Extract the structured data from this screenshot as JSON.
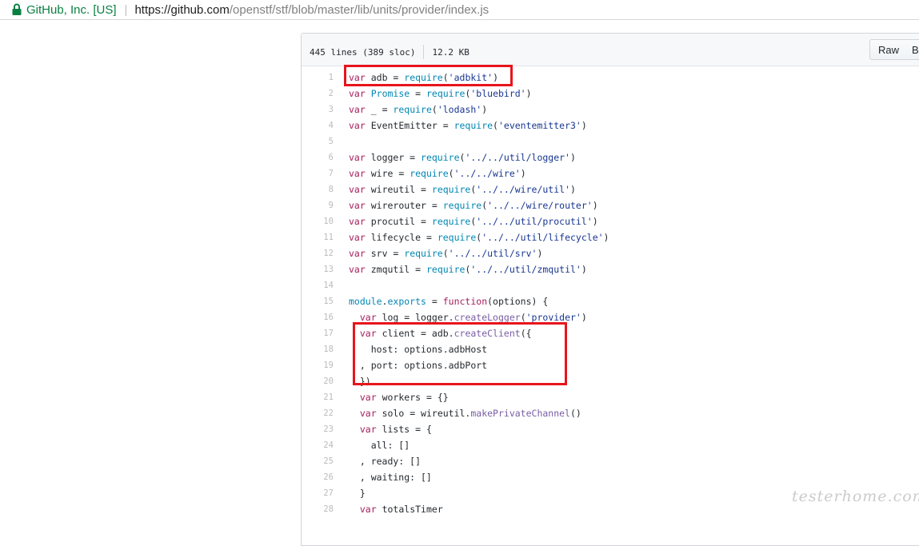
{
  "browser": {
    "secure_label": "GitHub, Inc. [US]",
    "url_host": "https://github.com",
    "url_path": "/openstf/stf/blob/master/lib/units/provider/index.js"
  },
  "file": {
    "lines_info": "445 lines (389 sloc)",
    "size": "12.2 KB",
    "raw_label": "Raw",
    "blame_label": "B"
  },
  "code_lines": [
    {
      "n": "1",
      "t": [
        [
          "kw",
          "var"
        ],
        [
          "",
          "adb = "
        ],
        [
          "bi",
          "require"
        ],
        [
          "",
          "("
        ],
        [
          "st",
          "'adbkit'"
        ],
        [
          "",
          ")"
        ]
      ]
    },
    {
      "n": "2",
      "t": [
        [
          "kw",
          "var"
        ],
        [
          "",
          ""
        ],
        [
          "bi",
          "Promise"
        ],
        [
          "",
          " = "
        ],
        [
          "bi",
          "require"
        ],
        [
          "",
          "("
        ],
        [
          "st",
          "'bluebird'"
        ],
        [
          "",
          ")"
        ]
      ]
    },
    {
      "n": "3",
      "t": [
        [
          "kw",
          "var"
        ],
        [
          "",
          "_ = "
        ],
        [
          "bi",
          "require"
        ],
        [
          "",
          "("
        ],
        [
          "st",
          "'lodash'"
        ],
        [
          "",
          ")"
        ]
      ]
    },
    {
      "n": "4",
      "t": [
        [
          "kw",
          "var"
        ],
        [
          "",
          "EventEmitter = "
        ],
        [
          "bi",
          "require"
        ],
        [
          "",
          "("
        ],
        [
          "st",
          "'eventemitter3'"
        ],
        [
          "",
          ")"
        ]
      ]
    },
    {
      "n": "5",
      "t": []
    },
    {
      "n": "6",
      "t": [
        [
          "kw",
          "var"
        ],
        [
          "",
          "logger = "
        ],
        [
          "bi",
          "require"
        ],
        [
          "",
          "("
        ],
        [
          "st",
          "'../../util/logger'"
        ],
        [
          "",
          ")"
        ]
      ]
    },
    {
      "n": "7",
      "t": [
        [
          "kw",
          "var"
        ],
        [
          "",
          "wire = "
        ],
        [
          "bi",
          "require"
        ],
        [
          "",
          "("
        ],
        [
          "st",
          "'../../wire'"
        ],
        [
          "",
          ")"
        ]
      ]
    },
    {
      "n": "8",
      "t": [
        [
          "kw",
          "var"
        ],
        [
          "",
          "wireutil = "
        ],
        [
          "bi",
          "require"
        ],
        [
          "",
          "("
        ],
        [
          "st",
          "'../../wire/util'"
        ],
        [
          "",
          ")"
        ]
      ]
    },
    {
      "n": "9",
      "t": [
        [
          "kw",
          "var"
        ],
        [
          "",
          "wirerouter = "
        ],
        [
          "bi",
          "require"
        ],
        [
          "",
          "("
        ],
        [
          "st",
          "'../../wire/router'"
        ],
        [
          "",
          ")"
        ]
      ]
    },
    {
      "n": "10",
      "t": [
        [
          "kw",
          "var"
        ],
        [
          "",
          "procutil = "
        ],
        [
          "bi",
          "require"
        ],
        [
          "",
          "("
        ],
        [
          "st",
          "'../../util/procutil'"
        ],
        [
          "",
          ")"
        ]
      ]
    },
    {
      "n": "11",
      "t": [
        [
          "kw",
          "var"
        ],
        [
          "",
          "lifecycle = "
        ],
        [
          "bi",
          "require"
        ],
        [
          "",
          "("
        ],
        [
          "st",
          "'../../util/lifecycle'"
        ],
        [
          "",
          ")"
        ]
      ]
    },
    {
      "n": "12",
      "t": [
        [
          "kw",
          "var"
        ],
        [
          "",
          "srv = "
        ],
        [
          "bi",
          "require"
        ],
        [
          "",
          "("
        ],
        [
          "st",
          "'../../util/srv'"
        ],
        [
          "",
          ")"
        ]
      ]
    },
    {
      "n": "13",
      "t": [
        [
          "kw",
          "var"
        ],
        [
          "",
          "zmqutil = "
        ],
        [
          "bi",
          "require"
        ],
        [
          "",
          "("
        ],
        [
          "st",
          "'../../util/zmqutil'"
        ],
        [
          "",
          ")"
        ]
      ]
    },
    {
      "n": "14",
      "t": []
    },
    {
      "n": "15",
      "t": [
        [
          "bi",
          "module"
        ],
        [
          "",
          "."
        ],
        [
          "bi",
          "exports"
        ],
        [
          "",
          " = "
        ],
        [
          "kw",
          "function"
        ],
        [
          "",
          "(options) {"
        ]
      ]
    },
    {
      "n": "16",
      "t": [
        [
          "",
          "  "
        ],
        [
          "kw",
          "var"
        ],
        [
          "",
          "log = logger."
        ],
        [
          "fn",
          "createLogger"
        ],
        [
          "",
          "("
        ],
        [
          "st",
          "'provider'"
        ],
        [
          "",
          ")"
        ]
      ]
    },
    {
      "n": "17",
      "t": [
        [
          "",
          "  "
        ],
        [
          "kw",
          "var"
        ],
        [
          "",
          "client = adb."
        ],
        [
          "fn",
          "createClient"
        ],
        [
          "",
          "({"
        ]
      ]
    },
    {
      "n": "18",
      "t": [
        [
          "",
          "    host: options.adbHost"
        ]
      ]
    },
    {
      "n": "19",
      "t": [
        [
          "",
          "  , port: options.adbPort"
        ]
      ]
    },
    {
      "n": "20",
      "t": [
        [
          "",
          "  })"
        ]
      ]
    },
    {
      "n": "21",
      "t": [
        [
          "",
          "  "
        ],
        [
          "kw",
          "var"
        ],
        [
          "",
          "workers = {}"
        ]
      ]
    },
    {
      "n": "22",
      "t": [
        [
          "",
          "  "
        ],
        [
          "kw",
          "var"
        ],
        [
          "",
          "solo = wireutil."
        ],
        [
          "fn",
          "makePrivateChannel"
        ],
        [
          "",
          "()"
        ]
      ]
    },
    {
      "n": "23",
      "t": [
        [
          "",
          "  "
        ],
        [
          "kw",
          "var"
        ],
        [
          "",
          "lists = {"
        ]
      ]
    },
    {
      "n": "24",
      "t": [
        [
          "",
          "    all: []"
        ]
      ]
    },
    {
      "n": "25",
      "t": [
        [
          "",
          "  , ready: []"
        ]
      ]
    },
    {
      "n": "26",
      "t": [
        [
          "",
          "  , waiting: []"
        ]
      ]
    },
    {
      "n": "27",
      "t": [
        [
          "",
          "  }"
        ]
      ]
    },
    {
      "n": "28",
      "t": [
        [
          "",
          "  "
        ],
        [
          "kw",
          "var"
        ],
        [
          "",
          "totalsTimer"
        ]
      ]
    }
  ],
  "watermark": "testerhome.com",
  "colors": {
    "highlight": "#e8141c",
    "secure": "#0b8043"
  }
}
